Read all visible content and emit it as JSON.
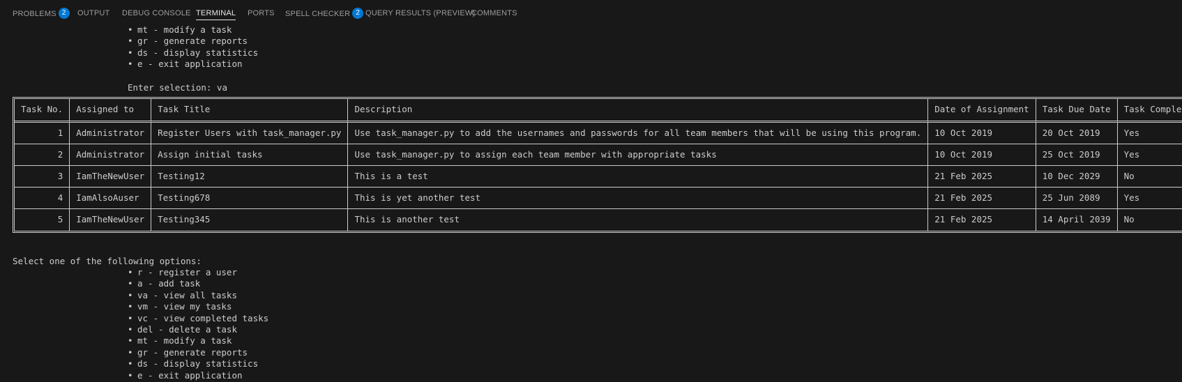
{
  "panel": {
    "tabs": [
      {
        "label": "PROBLEMS",
        "badge": "2"
      },
      {
        "label": "OUTPUT"
      },
      {
        "label": "DEBUG CONSOLE"
      },
      {
        "label": "TERMINAL",
        "active": true
      },
      {
        "label": "PORTS"
      },
      {
        "label": "SPELL CHECKER",
        "badge": "2"
      },
      {
        "label": "QUERY RESULTS (PREVIEW)"
      },
      {
        "label": "COMMENTS"
      }
    ]
  },
  "terminal": {
    "top_menu": [
      "mt - modify a task",
      "gr - generate reports",
      "ds - display statistics",
      "e - exit application"
    ],
    "bullet": "•",
    "prompt": "Enter selection: va",
    "table": {
      "headers": [
        "Task No.",
        "Assigned to",
        "Task Title",
        "Description",
        "Date of Assignment",
        "Task Due Date",
        "Task Completion"
      ],
      "rows": [
        [
          "1",
          "Administrator",
          "Register Users with task_manager.py",
          "Use task_manager.py to add the usernames and passwords for all team members that will be using this program.",
          "10 Oct 2019",
          "20 Oct 2019",
          "Yes"
        ],
        [
          "2",
          "Administrator",
          "Assign initial tasks",
          "Use task_manager.py to assign each team member with appropriate tasks",
          "10 Oct 2019",
          "25 Oct 2019",
          "Yes"
        ],
        [
          "3",
          "IamTheNewUser",
          "Testing12",
          "This is a test",
          "21 Feb 2025",
          "10 Dec 2029",
          "No"
        ],
        [
          "4",
          "IamAlsoAuser",
          "Testing678",
          "This is yet another test",
          "21 Feb 2025",
          "25 Jun 2089",
          "Yes"
        ],
        [
          "5",
          "IamTheNewUser",
          "Testing345",
          "This is another test",
          "21 Feb 2025",
          "14 April 2039",
          "No"
        ]
      ]
    },
    "select_heading": "Select one of the following options:",
    "bottom_menu": [
      "r - register a user",
      "a - add task",
      "va - view all tasks",
      "vm - view my tasks",
      "vc - view completed tasks",
      "del - delete a task",
      "mt - modify a task",
      "gr - generate reports",
      "ds - display statistics",
      "e - exit application"
    ]
  }
}
